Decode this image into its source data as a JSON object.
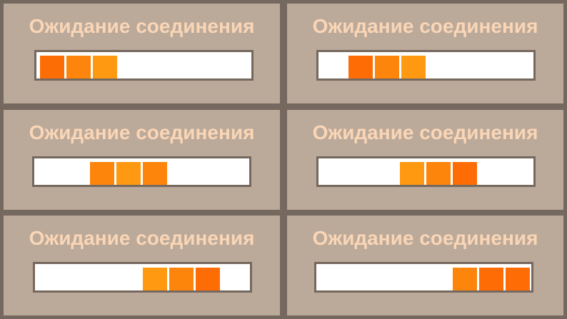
{
  "dialogs": [
    {
      "title": "Ожидание соединения",
      "segment_colors": [
        "#fd6d05",
        "#fe850b",
        "#fe9911"
      ]
    },
    {
      "title": "Ожидание соединения",
      "segment_colors": [
        "#fe6d05",
        "#fe850b",
        "#fe9911"
      ]
    },
    {
      "title": "Ожидание соединения",
      "segment_colors": [
        "#fe850b",
        "#fe9911",
        "#fe850b"
      ]
    },
    {
      "title": "Ожидание соединения",
      "segment_colors": [
        "#fe9911",
        "#fe850b",
        "#fe6d05"
      ]
    },
    {
      "title": "Ожидание соединения",
      "segment_colors": [
        "#fe9911",
        "#fe850b",
        "#fe6d05"
      ]
    },
    {
      "title": "Ожидание соединения",
      "segment_colors": [
        "#fe850b",
        "#fe6d05",
        "#fe6d05"
      ]
    }
  ],
  "colors": {
    "frame": "#75685e",
    "panel": "#bba99a",
    "title_text": "#fad6b6",
    "track": "#ffffff"
  }
}
